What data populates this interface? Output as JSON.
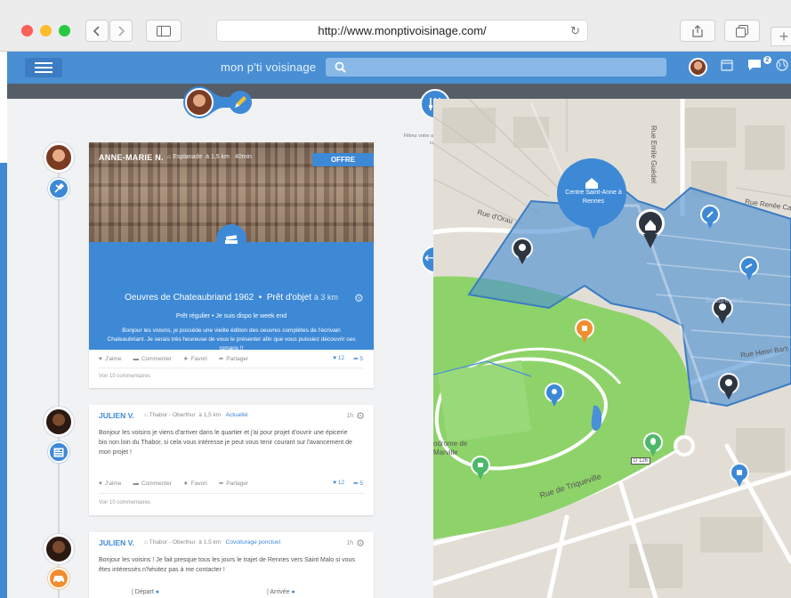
{
  "browser": {
    "url": "http://www.monptivoisinage.com/"
  },
  "app": {
    "logo": "mon p'ti voisinage",
    "notification_count": "2"
  },
  "filter": {
    "label": "Filtrez votre actualité et votre carte"
  },
  "posts": [
    {
      "author": "ANNE-MARIE N.",
      "location": "Esplanade",
      "distance": "à 1,5 km",
      "time": "40min",
      "badge": "OFFRE",
      "title": "Oeuvres de Chateaubriand 1962",
      "type": "Prêt d'objet",
      "type_distance": "à 3 km",
      "subtitle": "Prêt régulier  •  Je suis dispo le week end",
      "text": "Bonjour les voisins, je possède une vieille édition des oeuvres complètes de l'écrivain Chateaubriant. Je serais très heureuse de vous le présenter afin que vous puissiez découvrir ces romans !!",
      "cta": "Ça m'intéresse !",
      "like": "J'aime",
      "comment": "Commenter",
      "favorite": "Favori",
      "share": "Partager",
      "likes_count": "12",
      "shares_count": "5",
      "comments_link": "Voir 10 commentaires",
      "category_icon": "tools-icon"
    },
    {
      "author": "JULIEN V.",
      "location": "Thabor - Oberthur",
      "distance": "à 1,5 km",
      "tag": "Actualité",
      "time": "1h",
      "text": "Bonjour les voisins je viens d'arriver dans le quartier et j'ai pour projet d'ouvrir une épicerie bio non loin du Thabor, si cela vous intéresse je peut vous tenir courant sur l'avancement de mon projet !",
      "like": "J'aime",
      "comment": "Commenter",
      "favorite": "Favori",
      "share": "Partager",
      "likes_count": "12",
      "shares_count": "5",
      "comments_link": "Voir 10 commentaires",
      "category_icon": "news-icon"
    },
    {
      "author": "JULIEN V.",
      "location": "Thabor - Oberthur",
      "distance": "à 1,5 km",
      "tag": "Covoiturage ponctuel",
      "time": "1h",
      "text": "Bonjour les voisins ! Je fait presque tous les jours le trajet de Rennes vers Saint Malo si vous êtes intéressés n'hésitez pas à me contacter !",
      "depart": "Départ",
      "arrivee": "Arrivée",
      "category_icon": "car-icon"
    }
  ],
  "map": {
    "zone_label": "Centre Saint-Anne à Rennes",
    "streets": {
      "rue_dorau": "Rue d'Orau",
      "rue_renee_cap": "Rue Renée Cap",
      "rue_henri_barb": "Rue Henri Barb",
      "rue_de_triqueville": "Rue de Triqueville",
      "rue_emile_guedel": "Rue Emile Guédel",
      "beauregard": "Beauregard",
      "hippodrome": "odrome de",
      "marville": "Marville",
      "d126": "D 126"
    },
    "colors": {
      "zone": "#4a8fd4",
      "park": "#8ed36a",
      "pin_dark": "#2d3540",
      "pin_blue": "#3d89d6"
    }
  }
}
